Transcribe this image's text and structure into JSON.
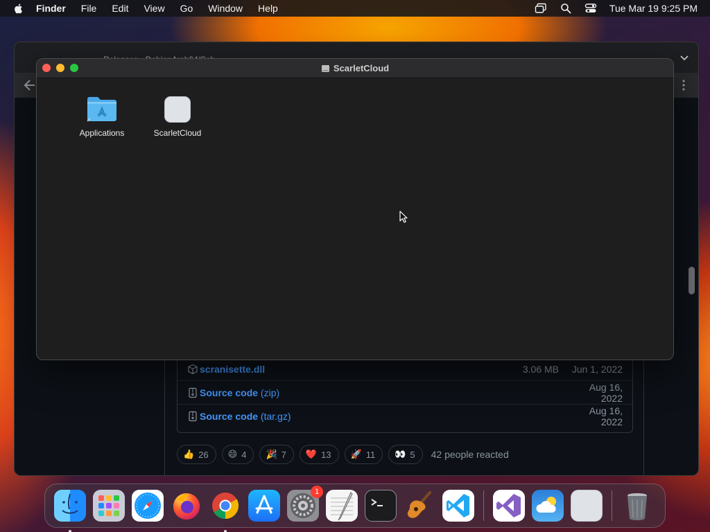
{
  "menubar": {
    "app_name": "Finder",
    "menus": [
      "File",
      "Edit",
      "View",
      "Go",
      "Window",
      "Help"
    ],
    "status_icons": [
      "screen-mirroring-icon",
      "spotlight-search-icon",
      "control-center-icon"
    ],
    "clock": "Tue Mar 19  9:25 PM"
  },
  "browser": {
    "tab_title": "Releases · DebianArch64/Sch",
    "assets": [
      {
        "icon": "package-icon",
        "name": "scranisette.dll",
        "size": "3.06 MB",
        "date": "Jun 1, 2022"
      },
      {
        "icon": "zip-file-icon",
        "name": "Source code",
        "suffix": " (zip)",
        "size": "",
        "date": "Aug 16, 2022"
      },
      {
        "icon": "zip-file-icon",
        "name": "Source code",
        "suffix": " (tar.gz)",
        "size": "",
        "date": "Aug 16, 2022"
      }
    ],
    "reactions": [
      {
        "emoji": "👍",
        "count": "26"
      },
      {
        "emoji": "😄",
        "count": "4"
      },
      {
        "emoji": "🎉",
        "count": "7"
      },
      {
        "emoji": "❤️",
        "count": "13"
      },
      {
        "emoji": "🚀",
        "count": "11"
      },
      {
        "emoji": "👀",
        "count": "5"
      }
    ],
    "reaction_summary": "42 people reacted"
  },
  "finder": {
    "window_title": "ScarletCloud",
    "items": [
      {
        "name": "Applications",
        "icon": "applications-folder-icon"
      },
      {
        "name": "ScarletCloud",
        "icon": "scarletcloud-app-icon"
      }
    ]
  },
  "dock": {
    "apps": [
      "Finder",
      "Launchpad",
      "Safari",
      "Firefox",
      "Chrome",
      "App Store",
      "System Settings",
      "TextEdit",
      "Terminal",
      "GarageBand",
      "Visual Studio Code"
    ],
    "recent_apps": [
      "Visual Studio",
      "Weather",
      "ScarletCloud"
    ],
    "system_settings_badge": "1",
    "colors": {
      "finder": "#1e8cff",
      "safari": "#1a9cff",
      "appstore": "#1c8cf5",
      "vscode": "#23a9f2"
    }
  }
}
